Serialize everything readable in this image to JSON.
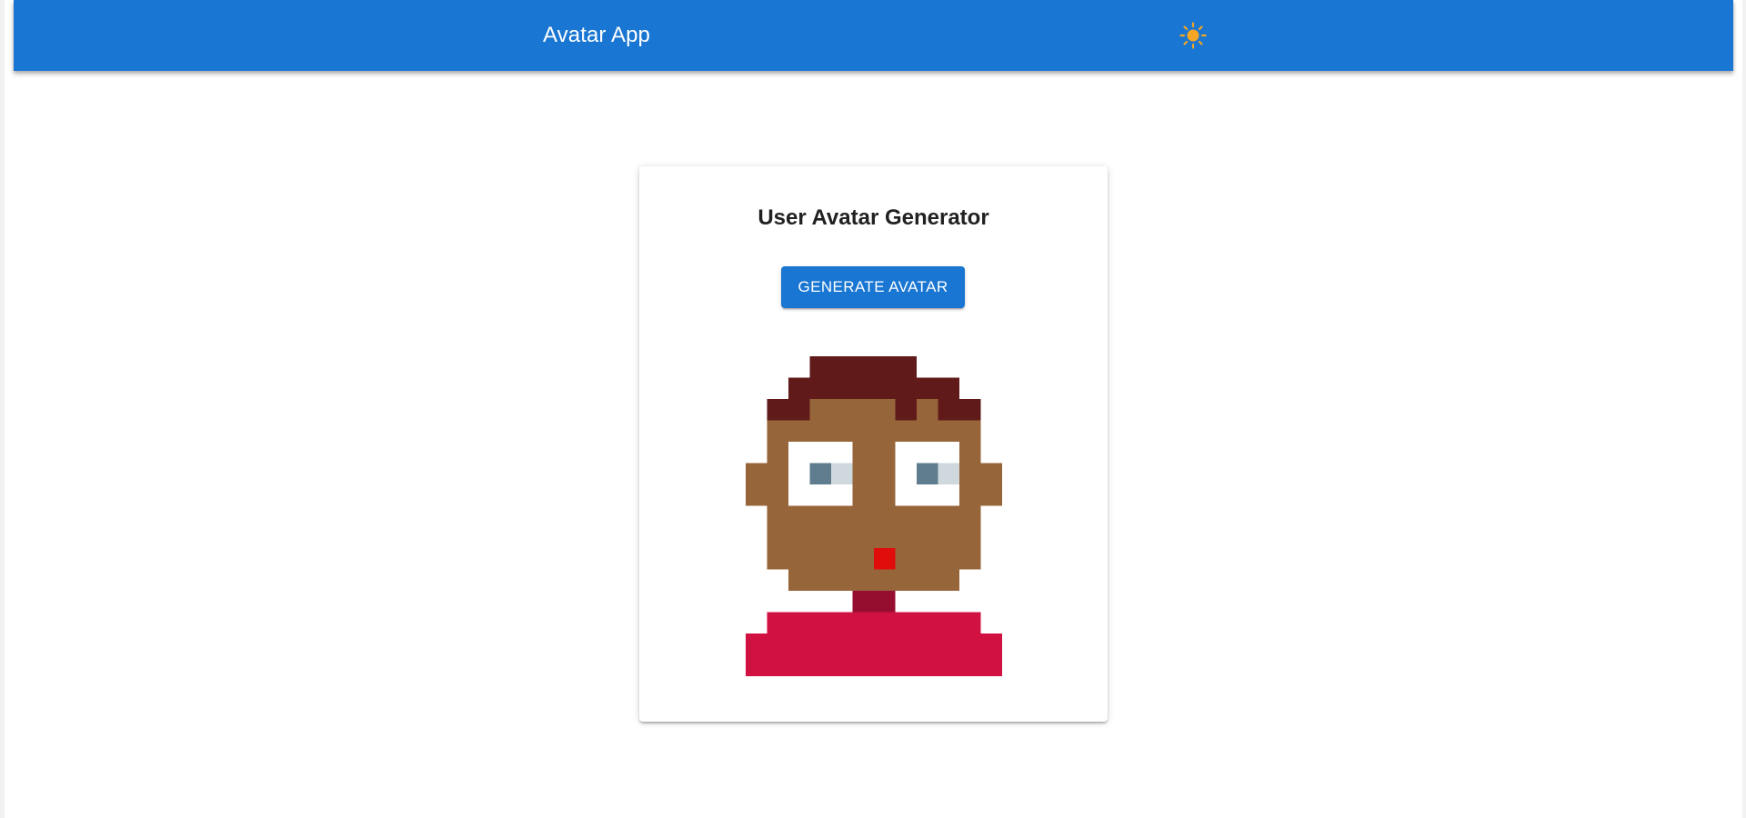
{
  "app_bar": {
    "title": "Avatar App",
    "theme_icon": "sun-icon",
    "background": "#1976d2",
    "icon_color": "#f5a623"
  },
  "card": {
    "title": "User Avatar Generator",
    "button_label": "GENERATE AVATAR"
  },
  "avatar": {
    "hair_color": "#611a1a",
    "skin_color": "#97653a",
    "eye_white": "#ffffff",
    "iris_color": "#5f7d8e",
    "eye_highlight": "#cfd8dc",
    "mouth_color": "#e10c0c",
    "neck_color": "#950e2f",
    "shirt_color": "#d11141"
  }
}
